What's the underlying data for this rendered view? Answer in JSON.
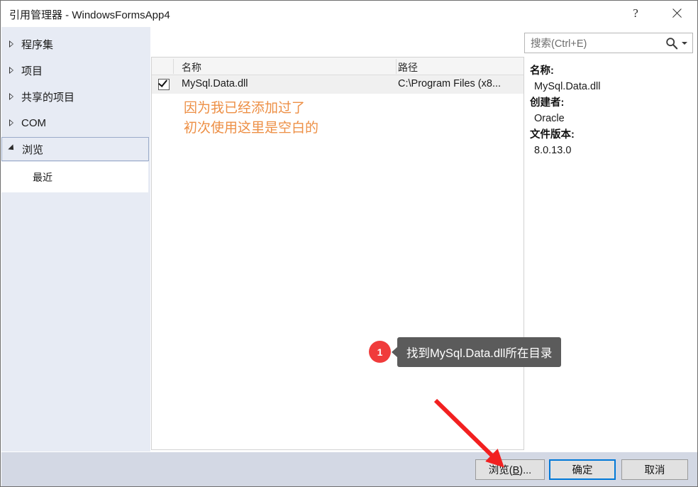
{
  "window": {
    "title": "引用管理器 - WindowsFormsApp4",
    "help_icon": "question-mark-icon",
    "close_icon": "close-icon"
  },
  "sidebar": {
    "items": [
      {
        "label": "程序集",
        "expanded": false,
        "selected": false
      },
      {
        "label": "项目",
        "expanded": false,
        "selected": false
      },
      {
        "label": "共享的项目",
        "expanded": false,
        "selected": false
      },
      {
        "label": "COM",
        "expanded": false,
        "selected": false
      },
      {
        "label": "浏览",
        "expanded": true,
        "selected": true
      }
    ],
    "child": {
      "label": "最近"
    }
  },
  "search": {
    "placeholder": "搜索(Ctrl+E)",
    "value": "",
    "icon": "search-icon",
    "dropdown_icon": "chevron-down-icon"
  },
  "list": {
    "columns": [
      "名称",
      "路径"
    ],
    "rows": [
      {
        "checked": true,
        "name": "MySql.Data.dll",
        "path": "C:\\Program Files (x8..."
      }
    ],
    "annotation": "因为我已经添加过了\n初次使用这里是空白的",
    "annotation_color": "#ed8f45"
  },
  "details": {
    "entries": [
      {
        "key": "名称:",
        "value": "MySql.Data.dll"
      },
      {
        "key": "创建者:",
        "value": "Oracle"
      },
      {
        "key": "文件版本:",
        "value": "8.0.13.0"
      }
    ]
  },
  "callout": {
    "number": "1",
    "text": "找到MySql.Data.dll所在目录",
    "badge_color": "#f03b3b",
    "bubble_color": "#5b5b5b",
    "arrow_color": "#f22020"
  },
  "footer": {
    "browse_label": "浏览(B)...",
    "browse_accel": "B",
    "ok_label": "确定",
    "cancel_label": "取消",
    "focus_color": "#0078d7"
  }
}
